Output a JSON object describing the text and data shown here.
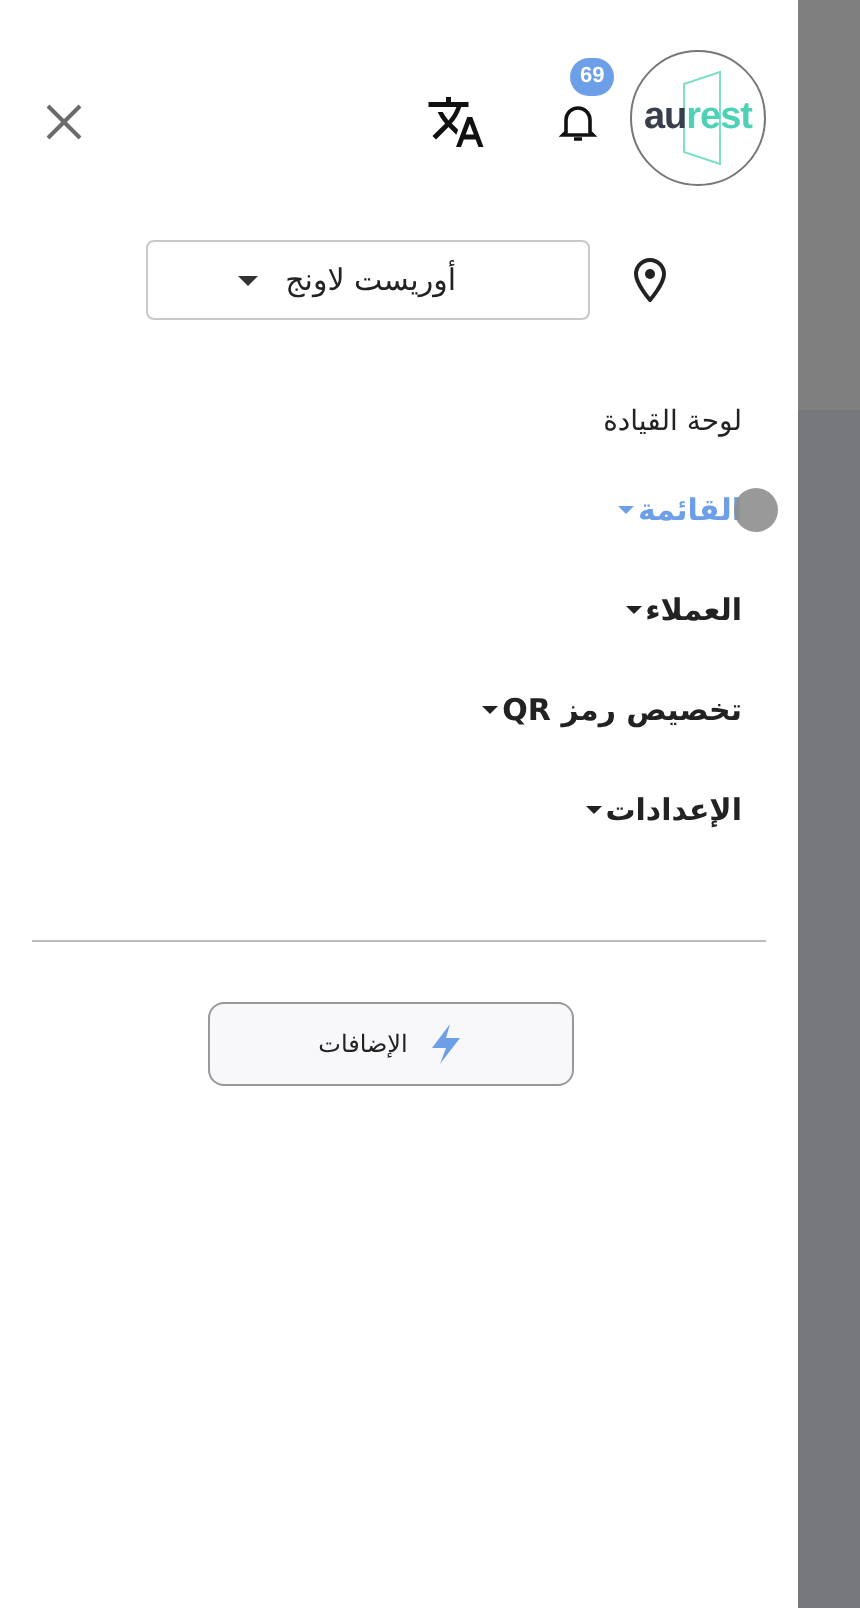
{
  "header": {
    "logo": {
      "dark_text": "au",
      "accent_text": "rest"
    },
    "notifications": {
      "count": "69"
    }
  },
  "branch": {
    "value": "أوريست لاونج"
  },
  "menu": [
    {
      "label": "لوحة القيادة",
      "selected": false,
      "expandable": false
    },
    {
      "label": "القائمة",
      "selected": true,
      "expandable": true
    },
    {
      "label": "العملاء",
      "selected": false,
      "expandable": true
    },
    {
      "label": "تخصيص رمز QR",
      "selected": false,
      "expandable": true
    },
    {
      "label": "الإعدادات",
      "selected": false,
      "expandable": true
    }
  ],
  "addons_button": {
    "label": "الإضافات"
  }
}
